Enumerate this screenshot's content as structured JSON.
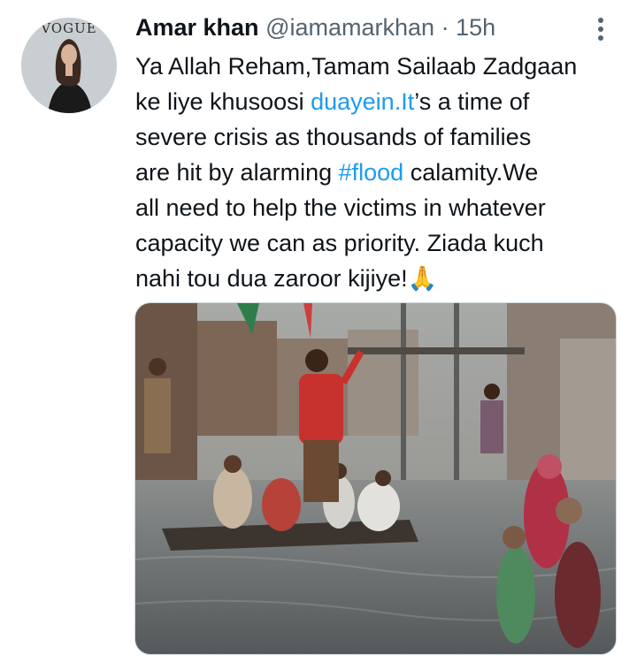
{
  "tweet": {
    "author_name": "Amar khan",
    "handle": "@iamamarkhan",
    "separator": "·",
    "timestamp": "15h",
    "avatar_text": "VOGUE",
    "text_lines": [
      [
        "Ya Allah Reham,Tamam Sailaab Zadgaan"
      ],
      [
        "ke liye khusoosi ",
        "duayein.It",
        "’s a time of"
      ],
      [
        "severe crisis as thousands of families"
      ],
      [
        "are hit by alarming ",
        "#flood",
        " calamity.We"
      ],
      [
        "all need to help the victims in whatever"
      ],
      [
        "capacity we can as priority. Ziada kuch"
      ],
      [
        "nahi tou dua zaroor kijiye!",
        "🙏"
      ]
    ],
    "link_text": "duayein.It",
    "hashtag": "#flood",
    "emoji_name": "folded-hands-emoji"
  },
  "colors": {
    "link": "#1d9bf0",
    "secondary_text": "#536471",
    "primary_text": "#0f1419",
    "water": "#6e7376"
  }
}
